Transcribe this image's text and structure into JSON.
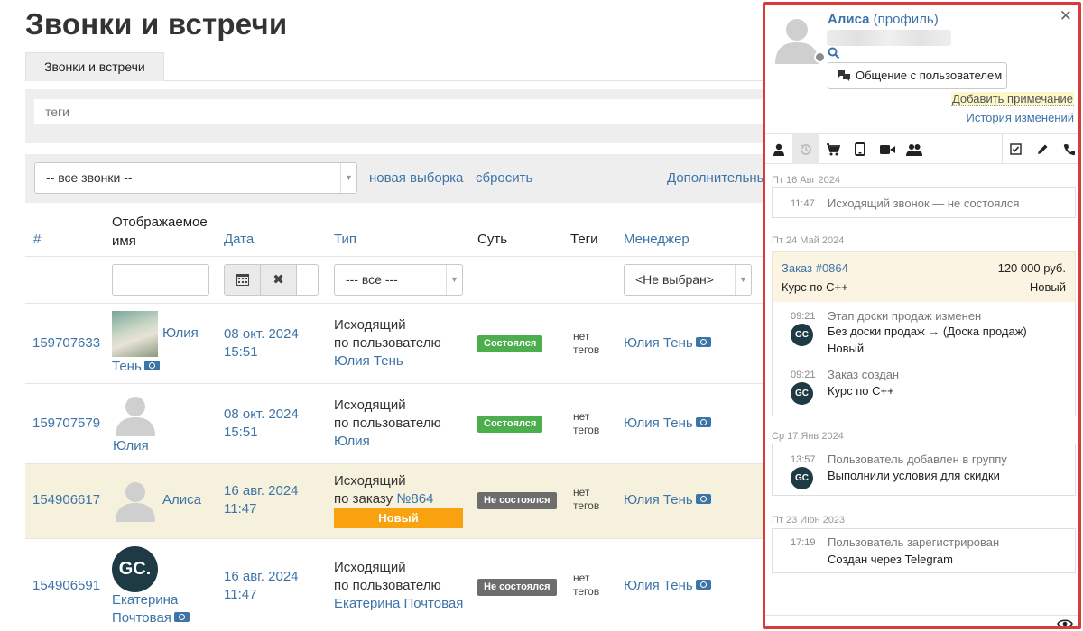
{
  "page": {
    "title": "Звонки и встречи",
    "tab": "Звонки и встречи",
    "tags_placeholder": "теги"
  },
  "filters": {
    "call_select": "-- все звонки --",
    "new_selection": "новая выборка",
    "reset": "сбросить",
    "more": "Дополнительны"
  },
  "table": {
    "headers": {
      "id": "#",
      "name_line1": "Отображаемое",
      "name_line2": "имя",
      "date": "Дата",
      "type": "Тип",
      "essence": "Суть",
      "tags": "Теги",
      "manager": "Менеджер"
    },
    "filter_type": "--- все ---",
    "filter_manager": "<Не выбран>",
    "rows": [
      {
        "id": "159707633",
        "name_a": "Юлия",
        "name_b": "Тень",
        "date": "08 окт. 2024",
        "time": "15:51",
        "type1": "Исходящий",
        "type2": "по пользователю",
        "type3": "Юлия Тень",
        "status": "Состоялся",
        "tags1": "нет",
        "tags2": "тегов",
        "manager": "Юлия Тень"
      },
      {
        "id": "159707579",
        "name_a": "Юлия",
        "date": "08 окт. 2024",
        "time": "15:51",
        "type1": "Исходящий",
        "type2": "по пользователю",
        "type3": "Юлия",
        "status": "Состоялся",
        "tags1": "нет",
        "tags2": "тегов",
        "manager": "Юлия Тень"
      },
      {
        "id": "154906617",
        "name_a": "Алиса",
        "date": "16 авг. 2024",
        "time": "11:47",
        "type1": "Исходящий",
        "type2_prefix": "по заказу",
        "type2_link": "№864",
        "order_status": "Новый",
        "status": "Не состоялся",
        "tags1": "нет",
        "tags2": "тегов",
        "manager": "Юлия Тень"
      },
      {
        "id": "154906591",
        "name_a": "Екатерина",
        "name_b": "Почтовая",
        "date": "16 авг. 2024",
        "time": "11:47",
        "type1": "Исходящий",
        "type2": "по пользователю",
        "type3": "Екатерина Почтовая",
        "status": "Не состоялся",
        "tags1": "нет",
        "tags2": "тегов",
        "manager": "Юлия Тень",
        "logo": "GC."
      }
    ]
  },
  "panel": {
    "name": "Алиса",
    "profile": "(профиль)",
    "chat_button": "Общение с пользователем",
    "add_note": "Добавить примечание",
    "history": "История изменений",
    "groups": [
      {
        "date": "Пт 16 Авг 2024",
        "events": [
          {
            "time": "11:47",
            "text": "Исходящий звонок — не состоялся"
          }
        ]
      },
      {
        "date": "Пт 24 Май 2024",
        "order": {
          "title": "Заказ #0864",
          "amount": "120 000 руб.",
          "product": "Курс по С++",
          "status": "Новый"
        },
        "events": [
          {
            "time": "09:21",
            "head": "Этап доски продаж изменен",
            "line1": "Без доски продаж → (Доска продаж)",
            "line2": "Новый"
          },
          {
            "time": "09:21",
            "head": "Заказ создан",
            "line1": "Курс по С++"
          }
        ]
      },
      {
        "date": "Ср 17 Янв 2024",
        "events": [
          {
            "time": "13:57",
            "head": "Пользователь добавлен в группу",
            "line1": "Выполнили условия для скидки"
          }
        ]
      },
      {
        "date": "Пт 23 Июн 2023",
        "events": [
          {
            "time": "17:19",
            "head": "Пользователь зарегистрирован",
            "line1": "Создан через Telegram"
          }
        ]
      }
    ],
    "logo_text": "GC"
  },
  "colors": {
    "accent": "#3d74a8",
    "success": "#4cae4c",
    "fail": "#6d6d6d",
    "order": "#f7a20e",
    "panel_border": "#d93b3b",
    "highlight_row": "#f6f1dc"
  },
  "icons": [
    "user-icon",
    "history-icon",
    "cart-icon",
    "tablet-icon",
    "video-icon",
    "group-icon",
    "checkbox-icon",
    "pencil-icon",
    "phone-icon",
    "close-icon",
    "search-icon",
    "chat-icon",
    "calendar-icon",
    "money-icon",
    "eye-icon"
  ]
}
